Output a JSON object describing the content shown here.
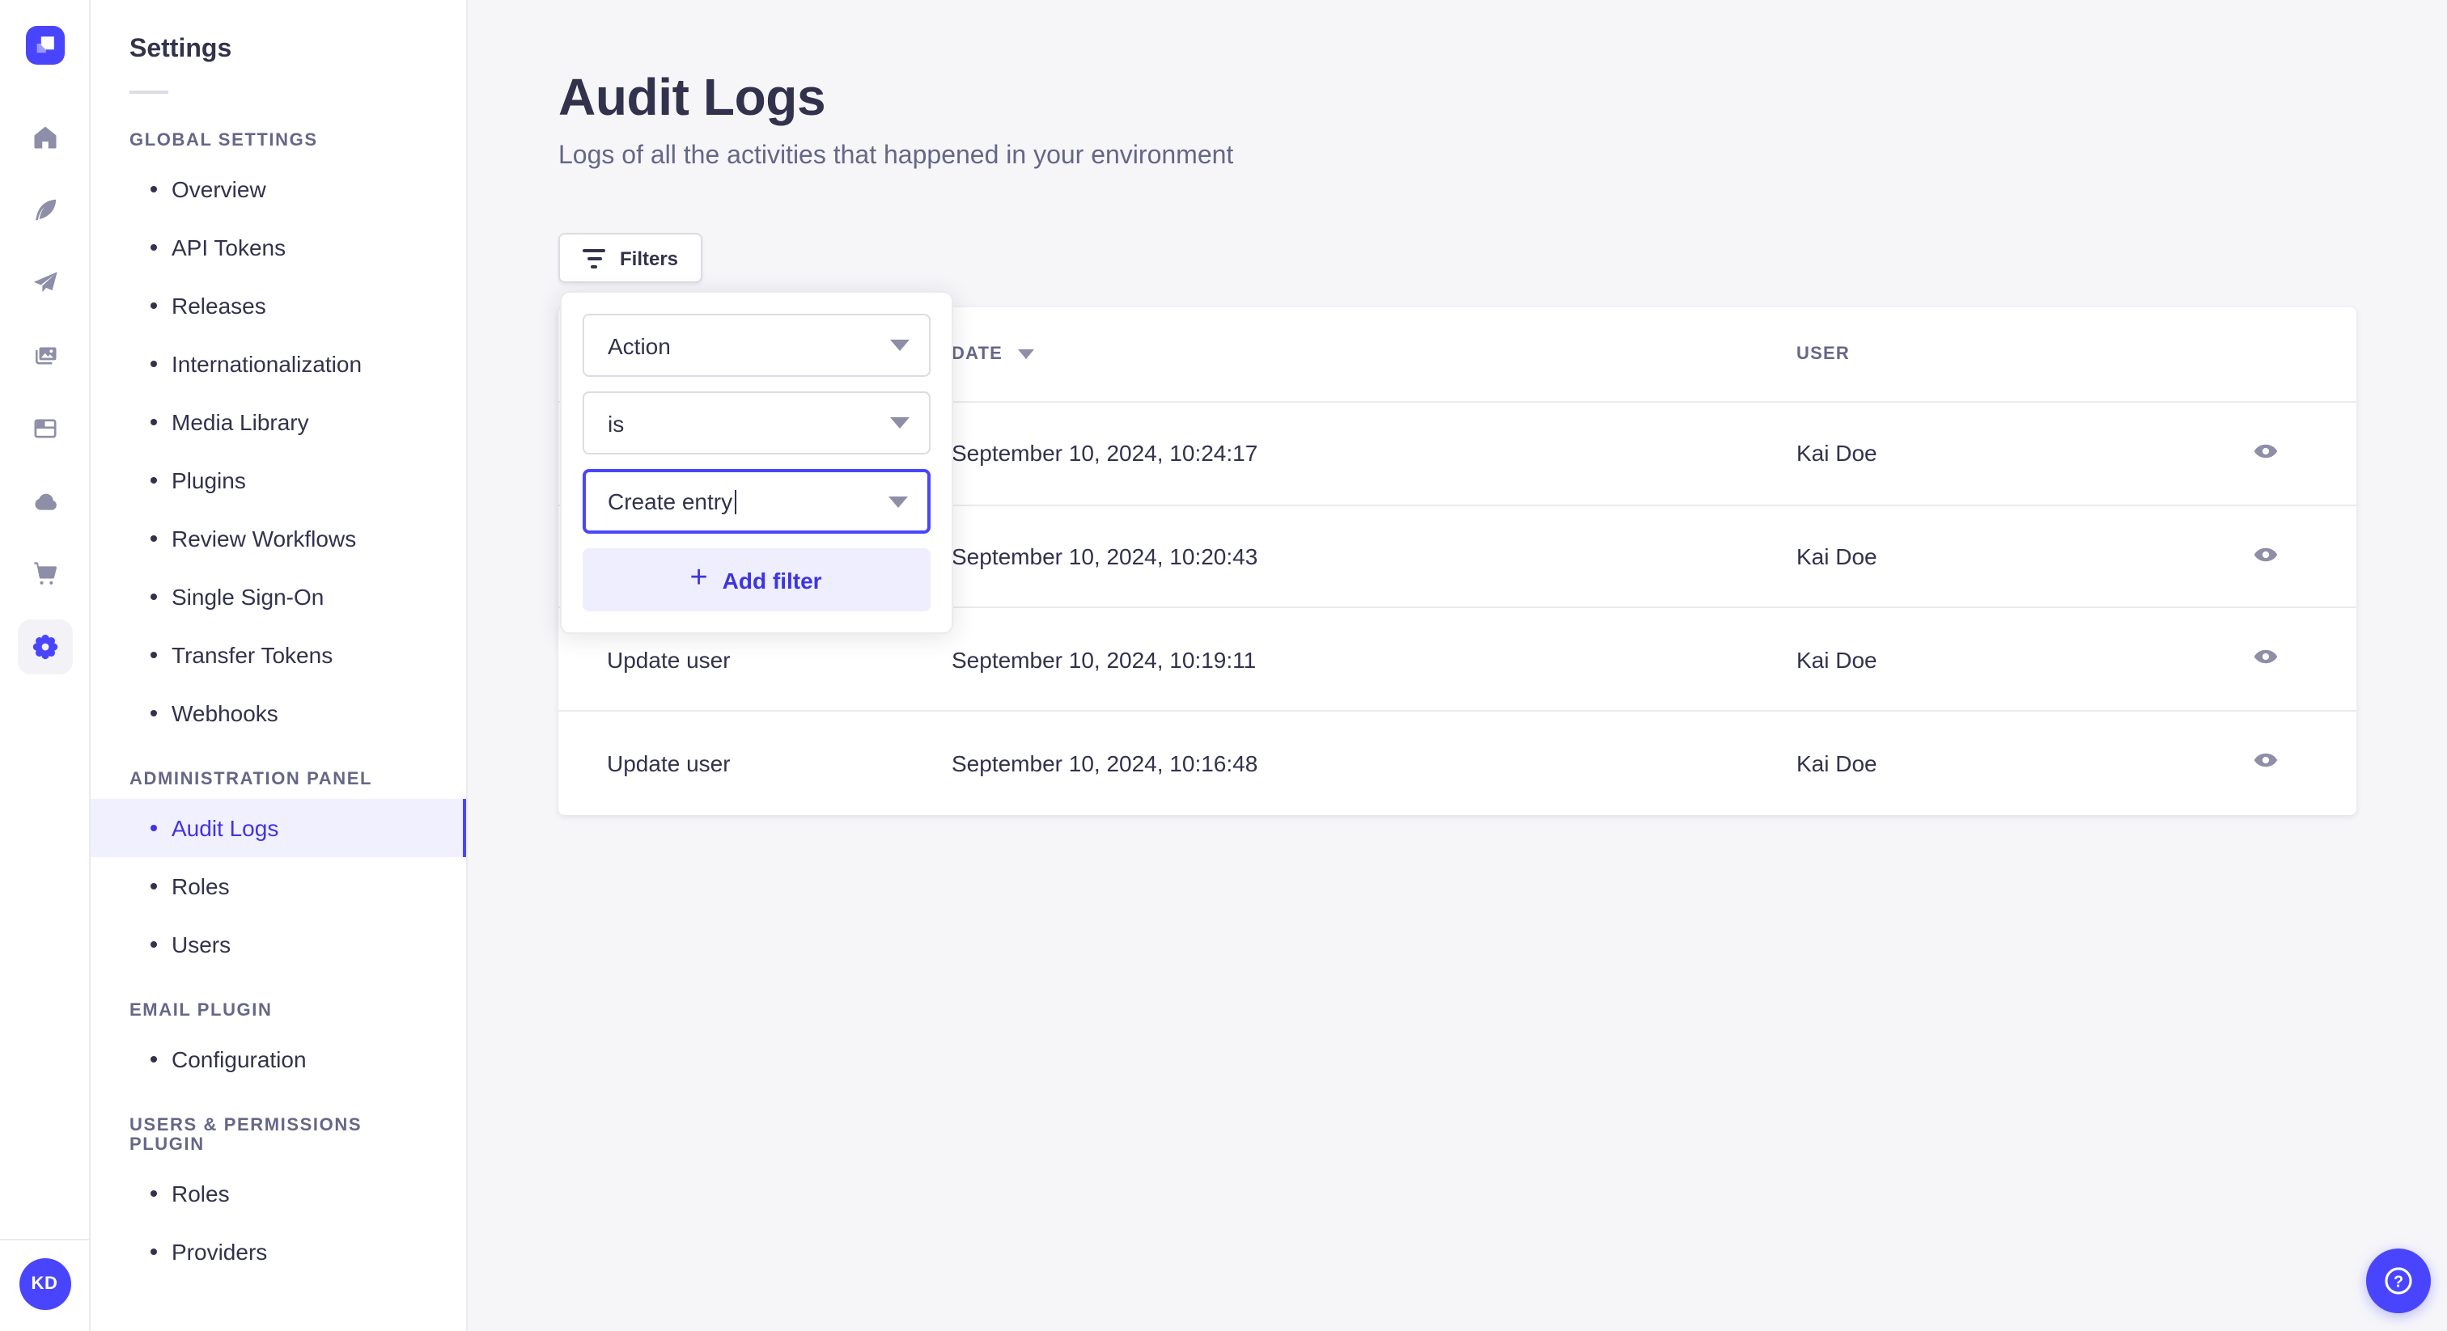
{
  "rail": {
    "logo_name": "strapi-logo",
    "icons": [
      {
        "name": "home-icon",
        "active": false
      },
      {
        "name": "feather-icon",
        "active": false
      },
      {
        "name": "paper-plane-icon",
        "active": false
      },
      {
        "name": "media-library-icon",
        "active": false
      },
      {
        "name": "layout-icon",
        "active": false
      },
      {
        "name": "cloud-icon",
        "active": false
      },
      {
        "name": "cart-icon",
        "active": false
      },
      {
        "name": "settings-gear-icon",
        "active": true
      }
    ],
    "avatar_initials": "KD"
  },
  "sidebar": {
    "title": "Settings",
    "sections": [
      {
        "label": "GLOBAL SETTINGS",
        "items": [
          {
            "label": "Overview"
          },
          {
            "label": "API Tokens"
          },
          {
            "label": "Releases"
          },
          {
            "label": "Internationalization"
          },
          {
            "label": "Media Library"
          },
          {
            "label": "Plugins"
          },
          {
            "label": "Review Workflows"
          },
          {
            "label": "Single Sign-On"
          },
          {
            "label": "Transfer Tokens"
          },
          {
            "label": "Webhooks"
          }
        ]
      },
      {
        "label": "ADMINISTRATION PANEL",
        "items": [
          {
            "label": "Audit Logs",
            "active": true
          },
          {
            "label": "Roles"
          },
          {
            "label": "Users"
          }
        ]
      },
      {
        "label": "EMAIL PLUGIN",
        "items": [
          {
            "label": "Configuration"
          }
        ]
      },
      {
        "label": "USERS & PERMISSIONS PLUGIN",
        "items": [
          {
            "label": "Roles"
          },
          {
            "label": "Providers"
          }
        ]
      }
    ]
  },
  "page": {
    "title": "Audit Logs",
    "subtitle": "Logs of all the activities that happened in your environment"
  },
  "filters": {
    "button_label": "Filters",
    "popover": {
      "field_value": "Action",
      "operator_value": "is",
      "action_value": "Create entry",
      "add_filter_label": "Add filter"
    }
  },
  "table": {
    "header": {
      "action": "",
      "date": "DATE",
      "user": "USER"
    },
    "date_sort": "desc",
    "rows": [
      {
        "action": "",
        "date": "September 10, 2024, 10:24:17",
        "user": "Kai Doe"
      },
      {
        "action": "",
        "date": "September 10, 2024, 10:20:43",
        "user": "Kai Doe"
      },
      {
        "action": "Update user",
        "date": "September 10, 2024, 10:19:11",
        "user": "Kai Doe"
      },
      {
        "action": "Update user",
        "date": "September 10, 2024, 10:16:48",
        "user": "Kai Doe"
      }
    ]
  },
  "help": {
    "label": "?"
  },
  "colors": {
    "primary": "#4945ff",
    "primary_light": "#f0f0ff",
    "text": "#32324d",
    "muted": "#666687",
    "icon_gray": "#8e8ea9",
    "background": "#f6f6f9",
    "border": "#eaeaef"
  }
}
